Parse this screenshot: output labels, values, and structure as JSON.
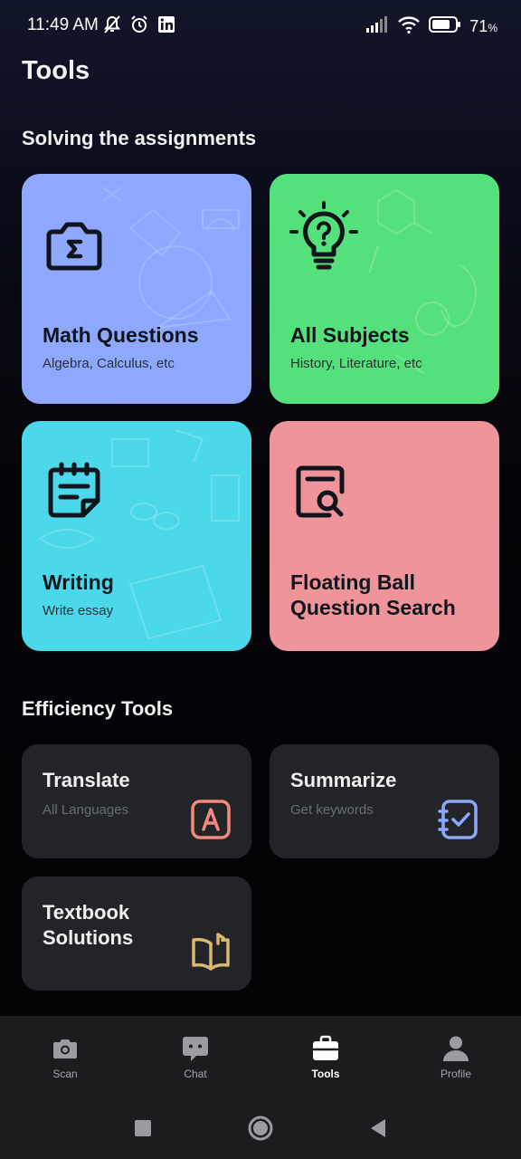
{
  "status_bar": {
    "time": "11:49 AM",
    "battery_percent": "71",
    "battery_unit": "%"
  },
  "page": {
    "title": "Tools"
  },
  "sections": {
    "assignments": "Solving the assignments",
    "efficiency": "Efficiency Tools"
  },
  "cards": [
    {
      "title": "Math Questions",
      "subtitle": "Algebra, Calculus, etc",
      "color": "#8ea8ff",
      "icon": "sigma-camera-icon"
    },
    {
      "title": "All Subjects",
      "subtitle": "History, Literature, etc",
      "color": "#54e07a",
      "icon": "lightbulb-question-icon"
    },
    {
      "title": "Writing",
      "subtitle": "Write essay",
      "color": "#4ad8ea",
      "icon": "notepad-icon"
    },
    {
      "title_line1": "Floating Ball",
      "title_line2": "Question Search",
      "color": "#f0949c",
      "icon": "search-document-icon"
    }
  ],
  "tools": [
    {
      "title": "Translate",
      "subtitle": "All Languages",
      "icon": "translate-a-icon",
      "icon_color": "#f08a7a"
    },
    {
      "title": "Summarize",
      "subtitle": "Get keywords",
      "icon": "checklist-icon",
      "icon_color": "#8ea8ff"
    },
    {
      "title_line1": "Textbook",
      "title_line2": "Solutions",
      "icon": "open-book-icon",
      "icon_color": "#d9b870"
    }
  ],
  "tabs": [
    {
      "label": "Scan",
      "icon": "camera-icon",
      "active": false
    },
    {
      "label": "Chat",
      "icon": "chat-bubble-icon",
      "active": false
    },
    {
      "label": "Tools",
      "icon": "briefcase-icon",
      "active": true
    },
    {
      "label": "Profile",
      "icon": "person-icon",
      "active": false
    }
  ]
}
